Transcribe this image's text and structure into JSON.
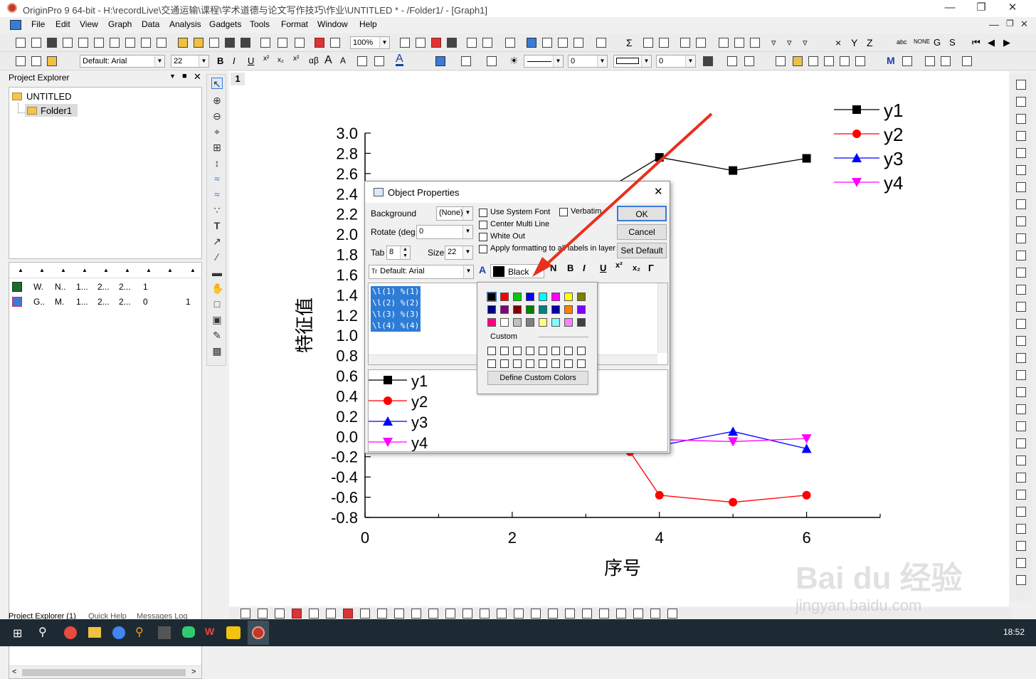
{
  "window": {
    "title": "OriginPro 9 64-bit - H:\\recordLive\\交通运输\\课程\\学术道德与论文写作技巧\\作业\\UNTITLED * - /Folder1/ - [Graph1]"
  },
  "menu": [
    "File",
    "Edit",
    "View",
    "Graph",
    "Data",
    "Analysis",
    "Gadgets",
    "Tools",
    "Format",
    "Window",
    "Help"
  ],
  "toolbar": {
    "zoom": "100%",
    "font": "Default: Arial",
    "size": "22",
    "line_width": "0",
    "angle": "0",
    "greek": "αβ"
  },
  "project_explorer": {
    "title": "Project Explorer",
    "root": "UNTITLED",
    "folder": "Folder1",
    "rows": [
      [
        "W.",
        "N..",
        "1...",
        "2...",
        "2...",
        "1",
        ""
      ],
      [
        "G..",
        "M.",
        "1...",
        "2...",
        "2...",
        "0",
        "1"
      ]
    ],
    "tabs": [
      "Project Explorer (1)",
      "Quick Help",
      "Messages Log"
    ]
  },
  "graph": {
    "page_number": "1",
    "xlabel": "序号",
    "ylabel": "特征值"
  },
  "chart_data": {
    "type": "line",
    "xlim": [
      0,
      7
    ],
    "ylim": [
      -0.8,
      3.0
    ],
    "x_ticks": [
      0,
      2,
      4,
      6
    ],
    "y_ticks": [
      "3.0",
      "2.8",
      "2.6",
      "2.4",
      "2.2",
      "2.0",
      "1.8",
      "1.6",
      "1.4",
      "1.2",
      "1.0",
      "0.8",
      "0.6",
      "0.4",
      "0.2",
      "0.0",
      "-0.2",
      "-0.4",
      "-0.6",
      "-0.8"
    ],
    "series": [
      {
        "name": "y1",
        "color": "#000000",
        "marker": "square",
        "x": [
          3,
          4,
          5,
          6
        ],
        "y": [
          2.32,
          2.76,
          2.63,
          2.75
        ]
      },
      {
        "name": "y2",
        "color": "#ff0000",
        "marker": "circle",
        "x": [
          3.6,
          4,
          5,
          6
        ],
        "y": [
          -0.15,
          -0.58,
          -0.65,
          -0.58
        ]
      },
      {
        "name": "y3",
        "color": "#0000ff",
        "marker": "triangle-up",
        "x": [
          3.6,
          4,
          5,
          6
        ],
        "y": [
          -0.1,
          -0.09,
          0.05,
          -0.12
        ]
      },
      {
        "name": "y4",
        "color": "#ff00ff",
        "marker": "triangle-down",
        "x": [
          3.6,
          4,
          5,
          6
        ],
        "y": [
          -0.03,
          -0.03,
          -0.05,
          -0.02
        ]
      }
    ],
    "legend": "top-right"
  },
  "dialog": {
    "title": "Object Properties",
    "background_label": "Background",
    "background_value": "(None)",
    "rotate_label": "Rotate (deg.)",
    "rotate_value": "0",
    "tab_label": "Tab",
    "tab_value": "8",
    "size_label": "Size",
    "size_value": "22",
    "font_value": "Default: Arial",
    "color_value": "Black",
    "checks": [
      "Use System Font",
      "Verbatim",
      "Center Multi Line",
      "White Out",
      "Apply formatting to all labels in layer"
    ],
    "ok": "OK",
    "cancel": "Cancel",
    "set_default": "Set Default",
    "text_lines": [
      "\\l(1) %(1)",
      "\\l(2) %(2)",
      "\\l(3) %(3)",
      "\\l(4) %(4)"
    ],
    "preview_legend": [
      "y1",
      "y2",
      "y3",
      "y4"
    ]
  },
  "palette": {
    "colors": [
      "#000000",
      "#ff0000",
      "#00cc00",
      "#0000ff",
      "#00ffff",
      "#ff00ff",
      "#ffff00",
      "#808000",
      "#000080",
      "#800080",
      "#800000",
      "#008000",
      "#008080",
      "#0000a0",
      "#ff8000",
      "#8000ff",
      "#ff0080",
      "#ffffff",
      "#c0c0c0",
      "#808080",
      "#ffff80",
      "#80ffff",
      "#ff80ff",
      "#404040"
    ],
    "custom_label": "Custom",
    "define_label": "Define Custom Colors"
  },
  "taskbar": {
    "time": "18:52"
  },
  "watermark": {
    "brand": "Bai du 经验",
    "url": "jingyan.baidu.com"
  }
}
